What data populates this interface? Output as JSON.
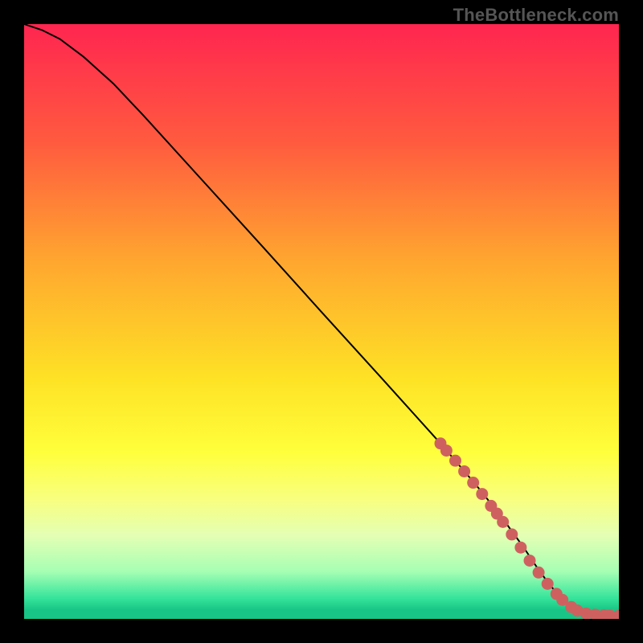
{
  "watermark": "TheBottleneck.com",
  "colors": {
    "background_black": "#000000",
    "curve": "#000000",
    "marker_fill": "#CE6160",
    "marker_stroke": "#CE6160",
    "gradient_stops": [
      {
        "offset": 0.0,
        "color": "#FF2550"
      },
      {
        "offset": 0.2,
        "color": "#FF5B3F"
      },
      {
        "offset": 0.4,
        "color": "#FFA72F"
      },
      {
        "offset": 0.6,
        "color": "#FEE325"
      },
      {
        "offset": 0.72,
        "color": "#FFFF3C"
      },
      {
        "offset": 0.8,
        "color": "#F8FF80"
      },
      {
        "offset": 0.86,
        "color": "#E4FFB4"
      },
      {
        "offset": 0.92,
        "color": "#A6FFB4"
      },
      {
        "offset": 0.965,
        "color": "#36E49B"
      },
      {
        "offset": 0.985,
        "color": "#18C586"
      },
      {
        "offset": 1.0,
        "color": "#18C586"
      }
    ]
  },
  "chart_data": {
    "type": "line",
    "title": "",
    "xlabel": "",
    "ylabel": "",
    "xlim": [
      0,
      100
    ],
    "ylim": [
      0,
      100
    ],
    "series": [
      {
        "name": "curve",
        "x": [
          0,
          3,
          6,
          10,
          15,
          20,
          30,
          40,
          50,
          60,
          70,
          76,
          80,
          84,
          86,
          88,
          90,
          92,
          94,
          96,
          98,
          100
        ],
        "y": [
          100,
          99,
          97.5,
          94.5,
          90,
          84.7,
          73.7,
          62.7,
          51.6,
          40.6,
          29.5,
          22.5,
          17.5,
          12,
          9,
          6.2,
          3.8,
          2.0,
          1.0,
          0.6,
          0.5,
          0.5
        ]
      }
    ],
    "markers": {
      "name": "highlight-points",
      "x": [
        70,
        71,
        72.5,
        74,
        75.5,
        77,
        78.5,
        79.5,
        80.5,
        82,
        83.5,
        85,
        86.5,
        88,
        89.5,
        90.5,
        92,
        93,
        94.5,
        96,
        97.5,
        98.5,
        100
      ],
      "y": [
        29.5,
        28.3,
        26.6,
        24.8,
        22.9,
        21.0,
        19.0,
        17.7,
        16.3,
        14.2,
        12.0,
        9.8,
        7.8,
        5.9,
        4.2,
        3.2,
        2.0,
        1.4,
        0.9,
        0.7,
        0.6,
        0.55,
        0.5
      ]
    }
  }
}
